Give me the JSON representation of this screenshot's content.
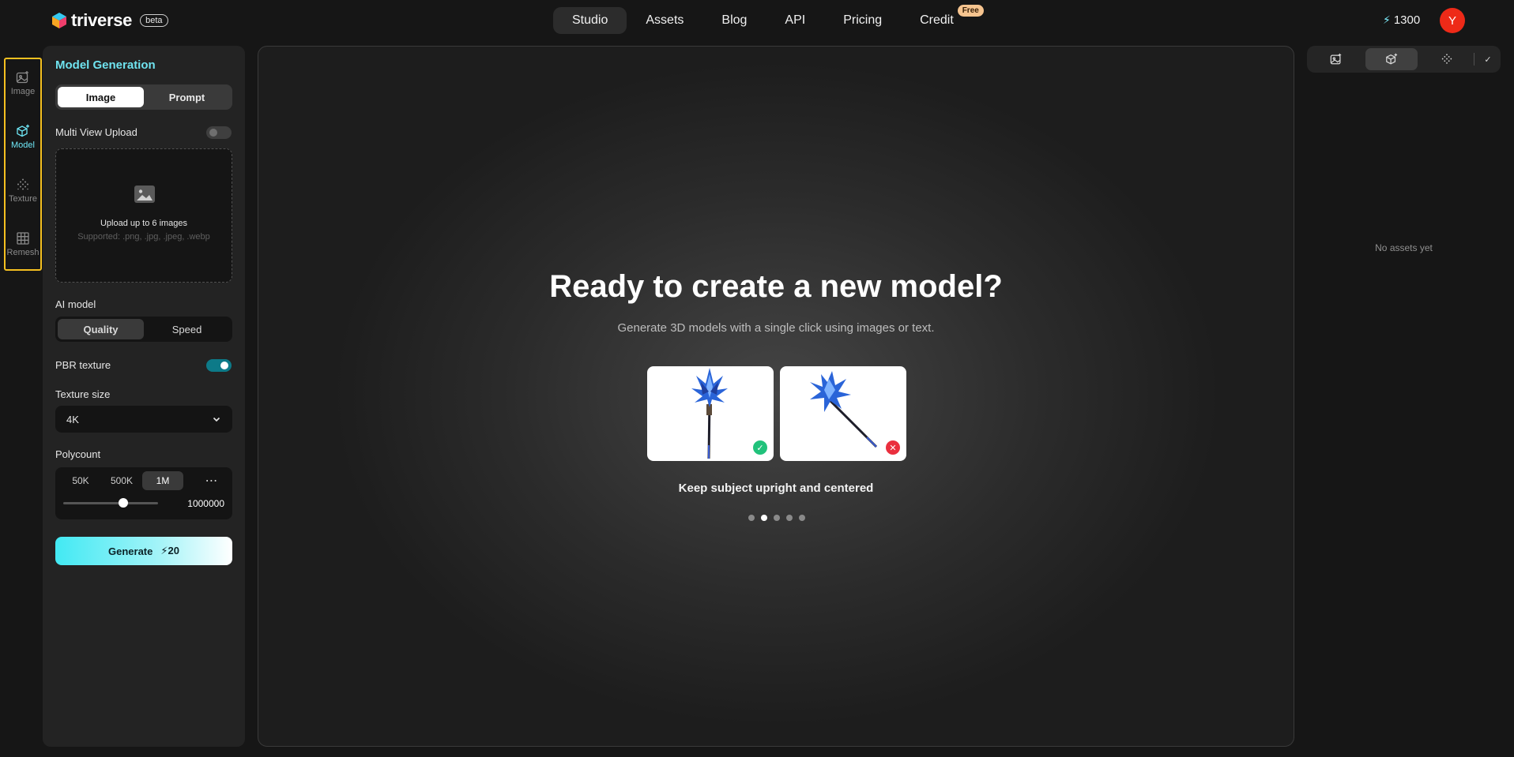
{
  "header": {
    "brand": "triverse",
    "beta_label": "beta",
    "nav": [
      {
        "label": "Studio",
        "active": true
      },
      {
        "label": "Assets",
        "active": false
      },
      {
        "label": "Blog",
        "active": false
      },
      {
        "label": "API",
        "active": false
      },
      {
        "label": "Pricing",
        "active": false
      },
      {
        "label": "Credit",
        "active": false,
        "badge": "Free"
      }
    ],
    "credits": "1300",
    "avatar_initial": "Y"
  },
  "rail": {
    "items": [
      {
        "label": "Image",
        "icon": "image-plus-icon",
        "active": false
      },
      {
        "label": "Model",
        "icon": "cube-plus-icon",
        "active": true
      },
      {
        "label": "Texture",
        "icon": "texture-dots-icon",
        "active": false
      },
      {
        "label": "Remesh",
        "icon": "grid-icon",
        "active": false
      }
    ]
  },
  "panel": {
    "title": "Model Generation",
    "input_mode": {
      "options": [
        "Image",
        "Prompt"
      ],
      "selected": "Image"
    },
    "multi_view_label": "Multi View Upload",
    "multi_view_enabled": false,
    "upload_text": "Upload up to 6 images",
    "upload_sub": "Supported: .png, .jpg, .jpeg, .webp",
    "ai_model_label": "AI model",
    "ai_model": {
      "options": [
        "Quality",
        "Speed"
      ],
      "selected": "Quality"
    },
    "pbr_label": "PBR texture",
    "pbr_enabled": true,
    "texture_size_label": "Texture size",
    "texture_size_value": "4K",
    "polycount_label": "Polycount",
    "polycount_options": [
      "50K",
      "500K",
      "1M"
    ],
    "polycount_selected": "1M",
    "polycount_value": "1000000",
    "generate_label": "Generate",
    "generate_cost": "20"
  },
  "main": {
    "title": "Ready to create a new model?",
    "subtitle": "Generate 3D models with a single click using images or text.",
    "tip": "Keep subject upright and centered",
    "carousel_count": 5,
    "carousel_active": 2
  },
  "right": {
    "empty_text": "No assets yet"
  },
  "colors": {
    "accent": "#6ee6f5",
    "highlight_border": "#f4c020",
    "avatar": "#ee2a18",
    "free_badge": "#f6c48f",
    "ok": "#21c27b",
    "bad": "#ea2f3e"
  }
}
